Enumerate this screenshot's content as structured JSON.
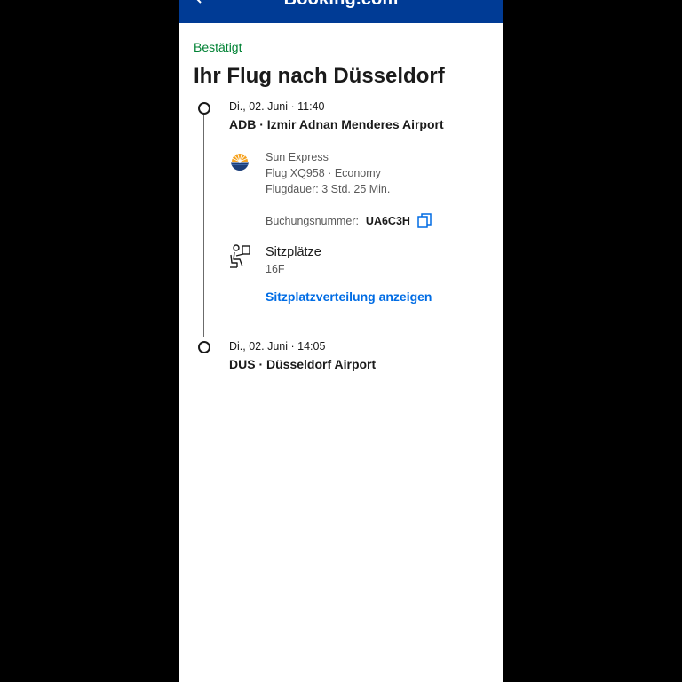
{
  "header": {
    "brand": "Booking.com"
  },
  "status": "Bestätigt",
  "title": "Ihr Flug nach Düsseldorf",
  "departure": {
    "time": "Di., 02. Juni · 11:40",
    "airport": "ADB · Izmir Adnan Menderes Airport"
  },
  "flight": {
    "airline": "Sun Express",
    "number_class": "Flug XQ958 · Economy",
    "duration": "Flugdauer: 3 Std. 25 Min.",
    "booking_label": "Buchungsnummer:",
    "booking_code": "UA6C3H"
  },
  "seats": {
    "label": "Sitzplätze",
    "value": "16F",
    "link": "Sitzplatzverteilung anzeigen"
  },
  "arrival": {
    "time": "Di., 02. Juni · 14:05",
    "airport": "DUS · Düsseldorf Airport"
  },
  "colors": {
    "header_bg": "#003b95",
    "status_green": "#008234",
    "link_blue": "#006ce4",
    "airline_orange": "#f6a21e",
    "airline_navy": "#1c3f7a"
  },
  "icons": {
    "back": "chevron-left-icon",
    "copy": "copy-icon",
    "seat": "seat-icon",
    "airline": "sun-express-logo-icon"
  }
}
